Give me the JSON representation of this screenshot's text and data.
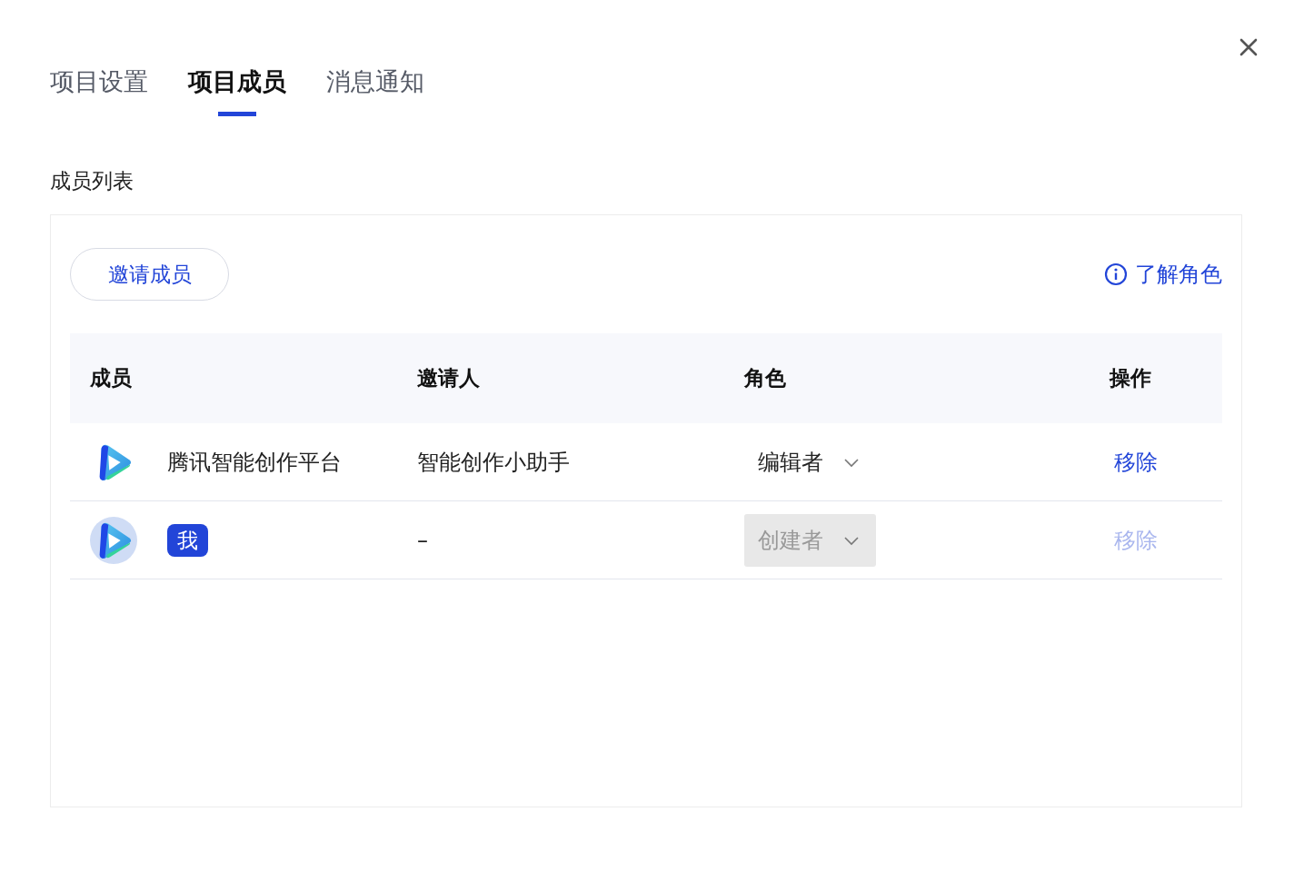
{
  "tabs": [
    {
      "label": "项目设置",
      "selected": false
    },
    {
      "label": "项目成员",
      "selected": true
    },
    {
      "label": "消息通知",
      "selected": false
    }
  ],
  "section_title": "成员列表",
  "invite_button": "邀请成员",
  "roles_link": "了解角色",
  "table": {
    "columns": [
      "成员",
      "邀请人",
      "角色",
      "操作"
    ],
    "rows": [
      {
        "avatar": {
          "kind": "logo"
        },
        "member": {
          "kind": "text",
          "text": "腾讯智能创作平台"
        },
        "inviter": "智能创作小助手",
        "role": "编辑者",
        "role_disabled": false,
        "action": "移除",
        "action_disabled": false
      },
      {
        "avatar": {
          "kind": "circle"
        },
        "member": {
          "kind": "badge",
          "text": "我"
        },
        "inviter": "–",
        "role": "创建者",
        "role_disabled": true,
        "action": "移除",
        "action_disabled": true
      }
    ]
  }
}
